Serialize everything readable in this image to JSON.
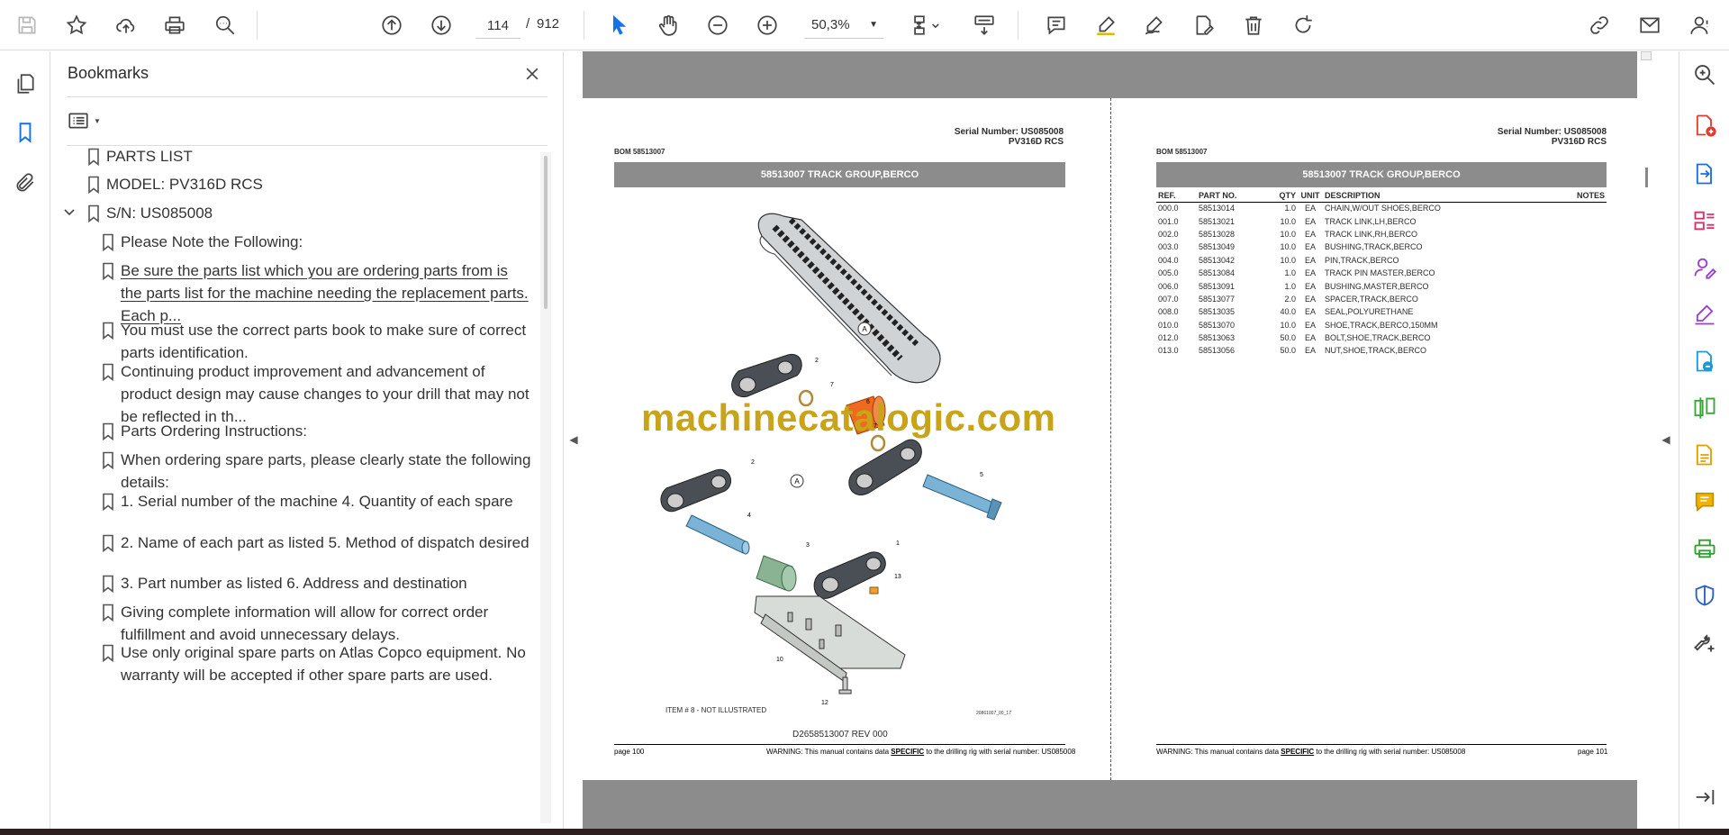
{
  "toolbar": {
    "page_current": "114",
    "page_sep": "/",
    "page_total": "912",
    "zoom": "50,3%"
  },
  "bookmarks": {
    "title": "Bookmarks",
    "items": [
      {
        "label": "PARTS LIST",
        "level": 1
      },
      {
        "label": "MODEL: PV316D RCS",
        "level": 1
      },
      {
        "label": "S/N: US085008",
        "level": 1
      },
      {
        "label": "Please Note the Following:",
        "level": 2
      },
      {
        "label": "Be sure the parts list which you are ordering parts from is the parts list for the machine needing the replacement parts. Each p...",
        "level": 2
      },
      {
        "label": "You must use the correct parts book to make sure of correct parts identification.",
        "level": 2
      },
      {
        "label": "Continuing product improvement and advancement of product design may cause changes to your drill that may not be reflected in th...",
        "level": 2
      },
      {
        "label": "Parts Ordering Instructions:",
        "level": 2
      },
      {
        "label": "When ordering spare parts, please clearly state the following details:",
        "level": 2
      },
      {
        "label": "1. Serial number of the machine 4. Quantity of each spare",
        "level": 2
      },
      {
        "label": "2. Name of each part as listed 5. Method of dispatch desired",
        "level": 2
      },
      {
        "label": "3. Part number as listed 6. Address and destination",
        "level": 2
      },
      {
        "label": "Giving complete information will allow for correct order fulfillment and avoid unnecessary delays.",
        "level": 2
      },
      {
        "label": "Use only original spare parts on Atlas Copco equipment. No warranty will be accepted if other spare parts are used.",
        "level": 2
      }
    ]
  },
  "doc": {
    "left": {
      "serial": "Serial Number: US085008",
      "model": "PV316D RCS",
      "bom": "BOM 58513007",
      "banner": "58513007 TRACK GROUP,BERCO",
      "not_illustrated": "ITEM # 8 - NOT ILLUSTRATED",
      "small_ref": "20861007_00_17",
      "drawing_ref": "D2658513007 REV 000",
      "page": "page 100",
      "warning_pre": "WARNING:  This manual contains data ",
      "warning_bold": "SPECIFIC",
      "warning_post": " to the drilling rig with serial number: US085008"
    },
    "right": {
      "serial": "Serial Number: US085008",
      "model": "PV316D RCS",
      "bom": "BOM 58513007",
      "banner": "58513007 TRACK GROUP,BERCO",
      "page": "page 101",
      "warning_pre": "WARNING:  This manual contains data ",
      "warning_bold": "SPECIFIC",
      "warning_post": " to the drilling rig with serial number: US085008",
      "headers": [
        "REF.",
        "PART NO.",
        "QTY",
        "UNIT",
        "DESCRIPTION",
        "NOTES"
      ],
      "rows": [
        [
          "000.0",
          "58513014",
          "1.0",
          "EA",
          "CHAIN,W/OUT SHOES,BERCO",
          ""
        ],
        [
          "001.0",
          "58513021",
          "10.0",
          "EA",
          "TRACK LINK,LH,BERCO",
          ""
        ],
        [
          "002.0",
          "58513028",
          "10.0",
          "EA",
          "TRACK LINK,RH,BERCO",
          ""
        ],
        [
          "003.0",
          "58513049",
          "10.0",
          "EA",
          "BUSHING,TRACK,BERCO",
          ""
        ],
        [
          "004.0",
          "58513042",
          "10.0",
          "EA",
          "PIN,TRACK,BERCO",
          ""
        ],
        [
          "005.0",
          "58513084",
          "1.0",
          "EA",
          "TRACK PIN MASTER,BERCO",
          ""
        ],
        [
          "006.0",
          "58513091",
          "1.0",
          "EA",
          "BUSHING,MASTER,BERCO",
          ""
        ],
        [
          "007.0",
          "58513077",
          "2.0",
          "EA",
          "SPACER,TRACK,BERCO",
          ""
        ],
        [
          "008.0",
          "58513035",
          "40.0",
          "EA",
          "SEAL,POLYURETHANE",
          ""
        ],
        [
          "010.0",
          "58513070",
          "10.0",
          "EA",
          "SHOE,TRACK,BERCO,150MM",
          ""
        ],
        [
          "012.0",
          "58513063",
          "50.0",
          "EA",
          "BOLT,SHOE,TRACK,BERCO",
          ""
        ],
        [
          "013.0",
          "58513056",
          "50.0",
          "EA",
          "NUT,SHOE,TRACK,BERCO",
          ""
        ]
      ]
    },
    "watermark": "machinecatalogic.com",
    "callouts": [
      "A",
      "2",
      "7",
      "6",
      "7",
      "5",
      "2",
      "A",
      "4",
      "3",
      "1",
      "13",
      "10",
      "12"
    ]
  },
  "colors": {
    "accent": "#1473e6",
    "banner": "#8c8c8c",
    "watermark": "#c8a418"
  }
}
